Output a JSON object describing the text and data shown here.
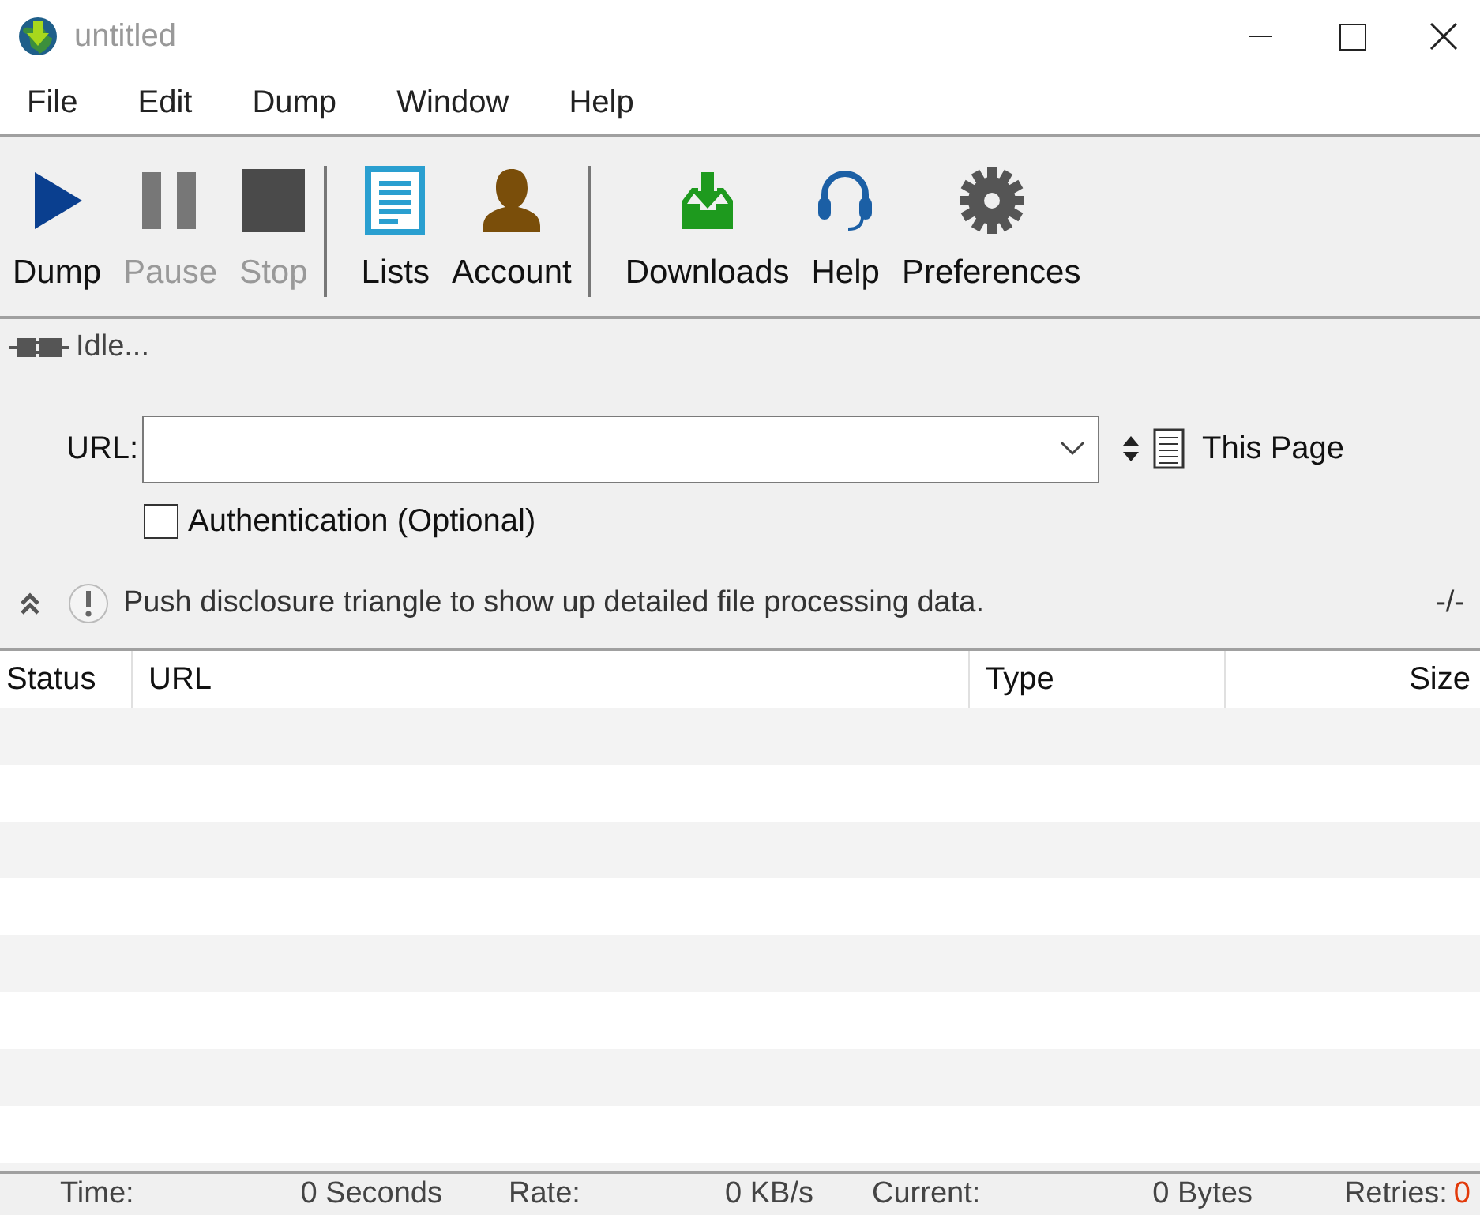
{
  "window": {
    "title": "untitled"
  },
  "menu": [
    "File",
    "Edit",
    "Dump",
    "Window",
    "Help"
  ],
  "toolbar": [
    [
      {
        "label": "Dump",
        "kind": "play",
        "disabled": false
      },
      {
        "label": "Pause",
        "kind": "pause",
        "disabled": true
      },
      {
        "label": "Stop",
        "kind": "stop",
        "disabled": true
      }
    ],
    [
      {
        "label": "Lists",
        "kind": "list",
        "disabled": false
      },
      {
        "label": "Account",
        "kind": "person",
        "disabled": false
      }
    ],
    [
      {
        "label": "Downloads",
        "kind": "download",
        "disabled": false
      },
      {
        "label": "Help",
        "kind": "headset",
        "disabled": false
      },
      {
        "label": "Preferences",
        "kind": "gear",
        "disabled": false
      }
    ]
  ],
  "status": "Idle...",
  "url": {
    "label": "URL:",
    "scope": "This Page"
  },
  "authentication": {
    "label": "Authentication (Optional)",
    "checked": false
  },
  "info": {
    "message": "Push disclosure triangle to show up detailed file processing data.",
    "counter": "-/-"
  },
  "table": {
    "columns": [
      "Status",
      "URL",
      "Type",
      "Size"
    ]
  },
  "status_bar": [
    {
      "label": "Time:",
      "value": "0  Seconds",
      "alert": false
    },
    {
      "label": "Rate:",
      "value": "0  KB/s",
      "alert": false
    },
    {
      "label": "Current:",
      "value": "0  Bytes",
      "alert": false
    },
    {
      "label": "Retries:",
      "value": "0",
      "alert": true
    }
  ]
}
